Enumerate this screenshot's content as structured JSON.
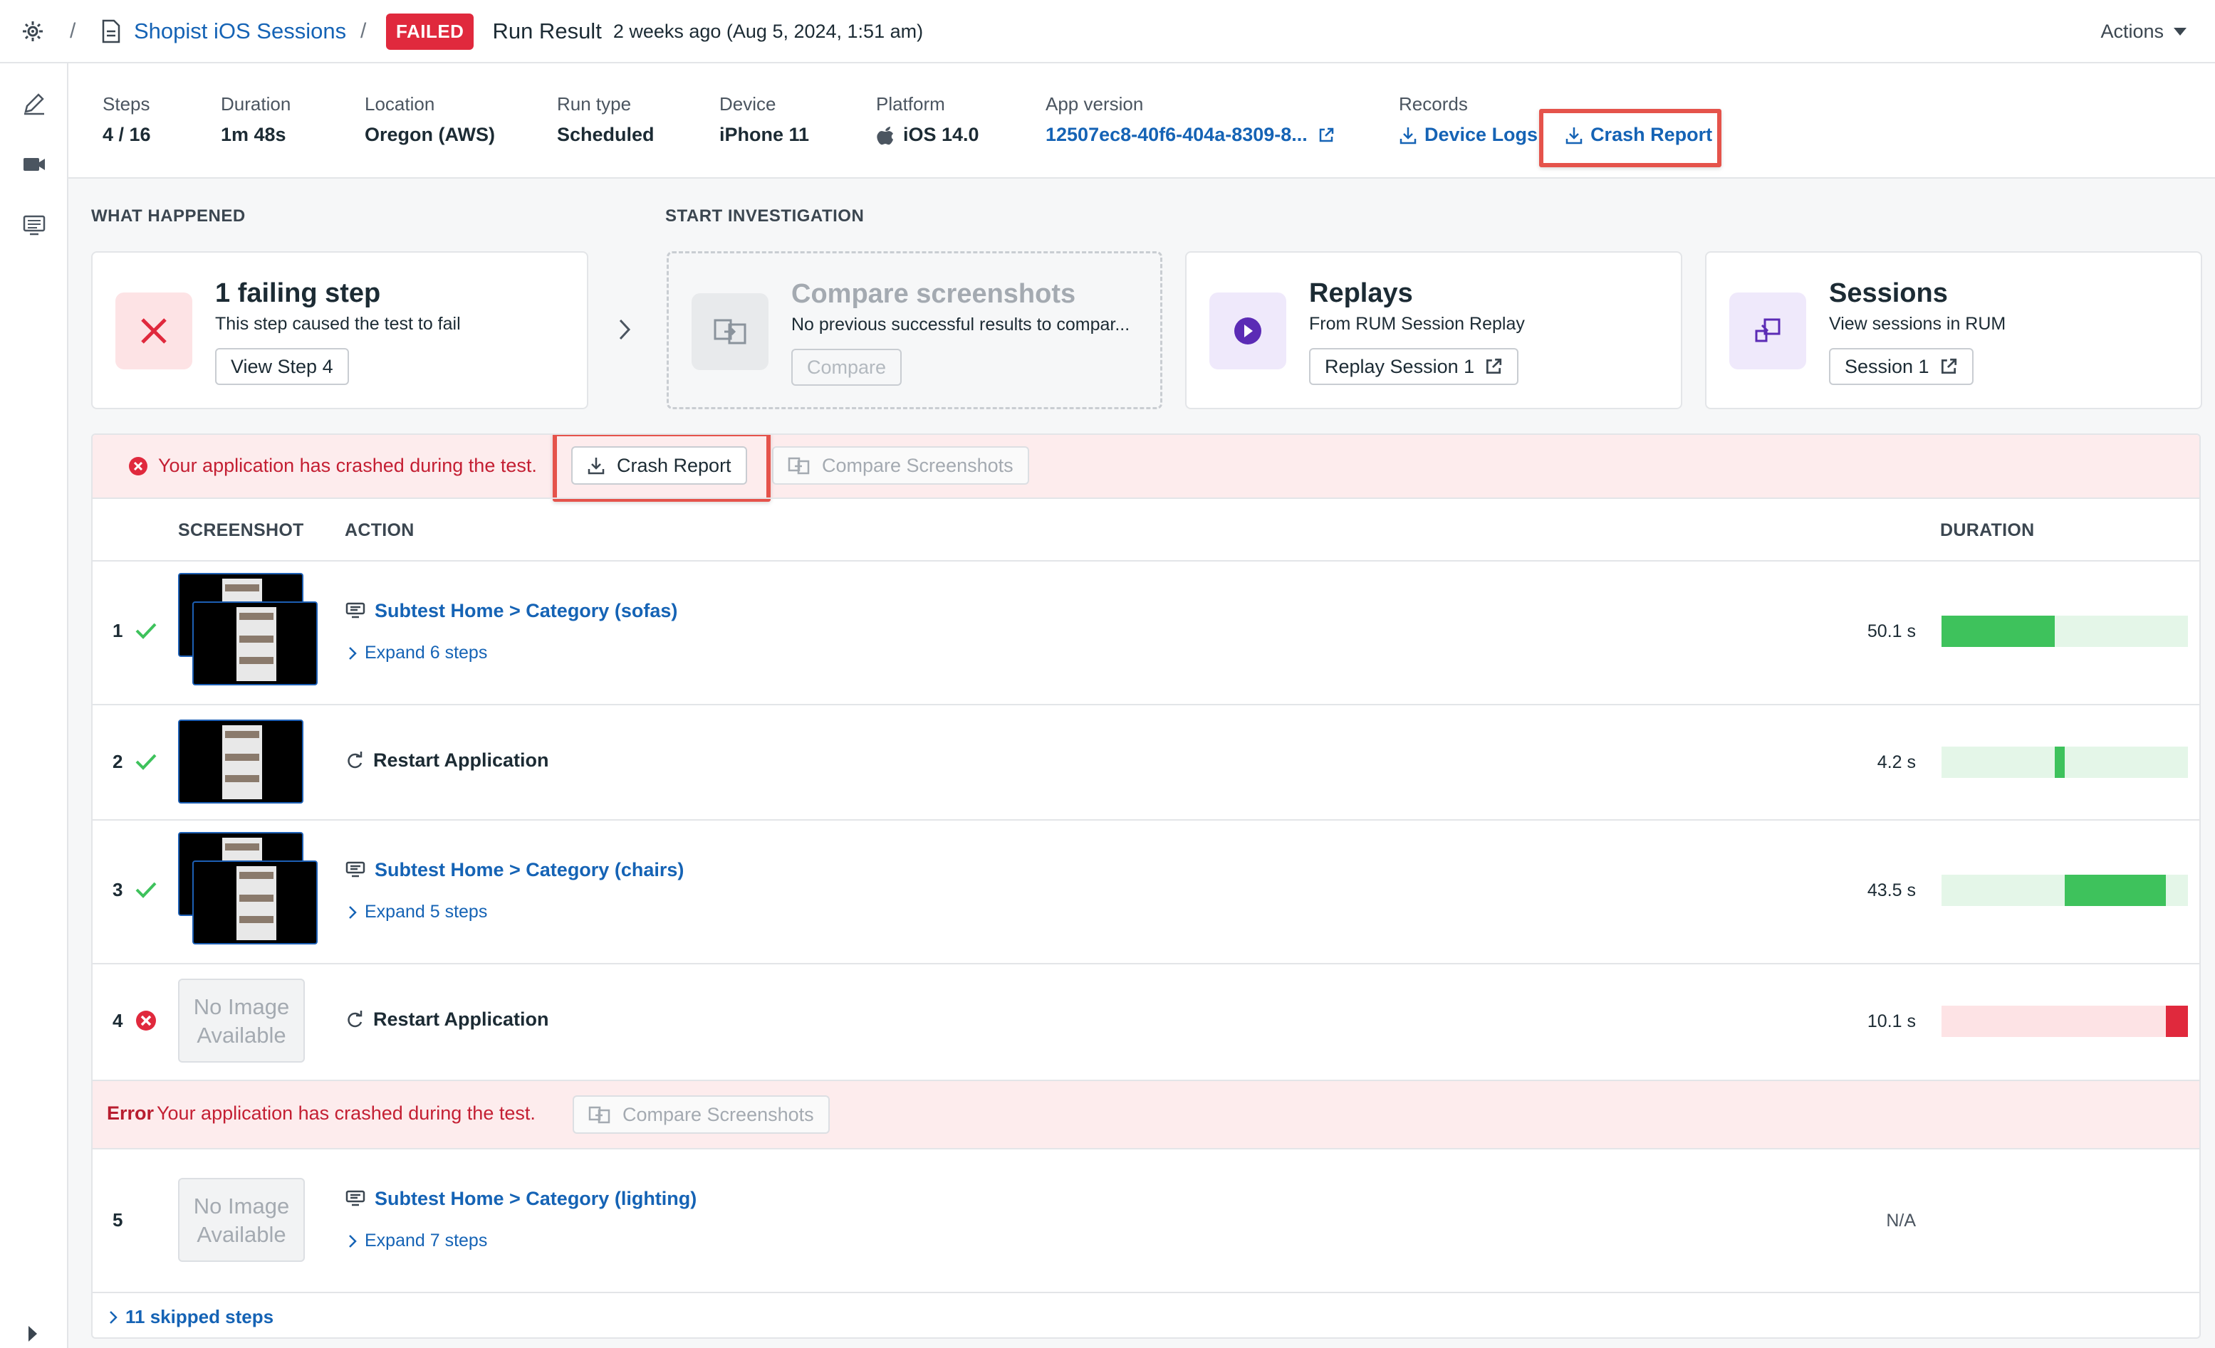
{
  "header": {
    "project": "Shopist iOS Sessions",
    "status": "FAILED",
    "title": "Run Result",
    "time": "2 weeks ago (Aug 5, 2024, 1:51 am)",
    "actions": "Actions",
    "separator": "/"
  },
  "meta": {
    "steps": {
      "label": "Steps",
      "value": "4 / 16"
    },
    "duration": {
      "label": "Duration",
      "value": "1m 48s"
    },
    "location": {
      "label": "Location",
      "value": "Oregon (AWS)"
    },
    "run_type": {
      "label": "Run type",
      "value": "Scheduled"
    },
    "device": {
      "label": "Device",
      "value": "iPhone 11"
    },
    "platform": {
      "label": "Platform",
      "value": "iOS 14.0"
    },
    "app_version": {
      "label": "App version",
      "value": "12507ec8-40f6-404a-8309-8..."
    },
    "records": {
      "label": "Records",
      "device_logs": "Device Logs",
      "crash_report": "Crash Report"
    }
  },
  "sections": {
    "what_happened": "WHAT HAPPENED",
    "start_investigation": "START INVESTIGATION"
  },
  "cards": {
    "failing": {
      "title": "1 failing step",
      "sub": "This step caused the test to fail",
      "button": "View Step 4"
    },
    "compare": {
      "title": "Compare screenshots",
      "sub": "No previous successful results to compar...",
      "button": "Compare"
    },
    "replays": {
      "title": "Replays",
      "sub": "From RUM Session Replay",
      "button": "Replay Session 1"
    },
    "sessions": {
      "title": "Sessions",
      "sub": "View sessions in RUM",
      "button": "Session 1"
    }
  },
  "banner": {
    "message": "Your application has crashed during the test.",
    "crash_button": "Crash Report",
    "compare_button": "Compare Screenshots"
  },
  "table": {
    "columns": {
      "screenshot": "SCREENSHOT",
      "action": "ACTION",
      "duration": "DURATION"
    },
    "rows": [
      {
        "num": "1",
        "action": "Subtest Home > Category (sofas)",
        "expand": "Expand 6 steps",
        "duration": "50.1 s",
        "bar_start": 0.0,
        "bar_end": 0.46
      },
      {
        "num": "2",
        "action": "Restart Application",
        "duration": "4.2 s",
        "bar_start": 0.46,
        "bar_end": 0.5
      },
      {
        "num": "3",
        "action": "Subtest Home > Category (chairs)",
        "expand": "Expand 5 steps",
        "duration": "43.5 s",
        "bar_start": 0.5,
        "bar_end": 0.91
      },
      {
        "num": "4",
        "action": "Restart Application",
        "duration": "10.1 s",
        "no_image": "No Image Available",
        "bar_start": 0.91,
        "bar_end": 1.0
      },
      {
        "num": "5",
        "action": "Subtest Home > Category (lighting)",
        "expand": "Expand 7 steps",
        "duration": "N/A",
        "no_image": "No Image Available"
      }
    ],
    "error_row": {
      "label": "Error",
      "message": "Your application has crashed during the test.",
      "button": "Compare Screenshots"
    },
    "skipped": "11 skipped steps"
  },
  "colors": {
    "accent": "#1563b5",
    "failed": "#e0293d",
    "success": "#3ec25c",
    "bar_bg_ok": "#e4f6e8",
    "bar_bg_fail": "#fde3e5",
    "highlight": "#e5534b"
  }
}
